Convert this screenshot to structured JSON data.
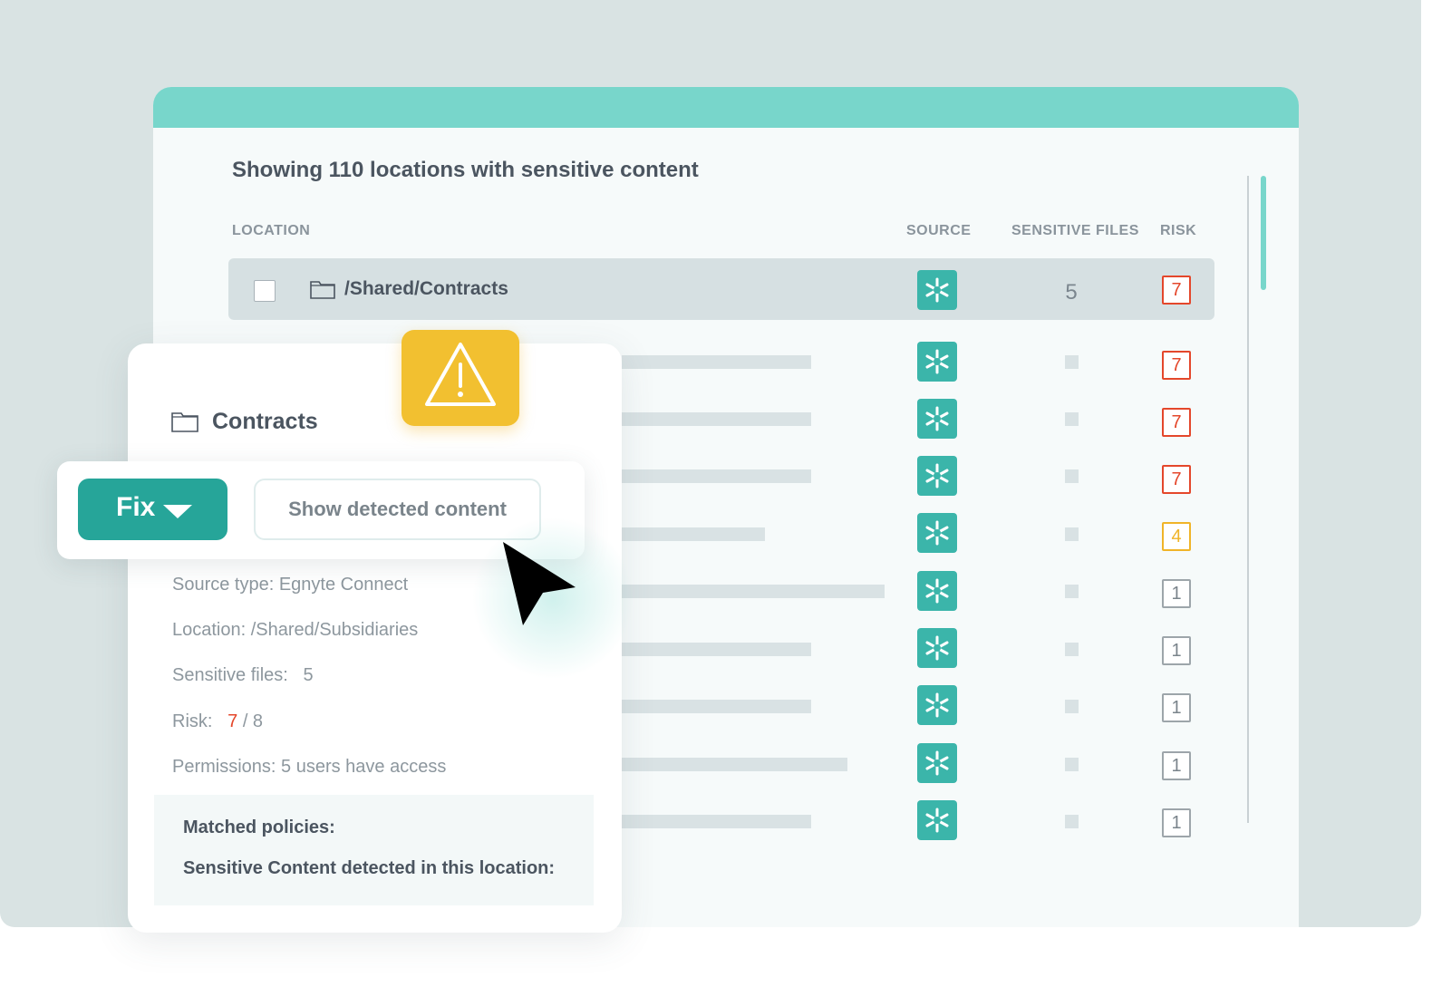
{
  "table": {
    "heading": "Showing 110 locations with sensitive content",
    "columns": {
      "location": "LOCATION",
      "source": "SOURCE",
      "sensitive_files": "SENSITIVE FILES",
      "risk": "RISK"
    },
    "selected_row": {
      "location": "/Shared/Contracts",
      "sensitive_files": "5",
      "risk": "7",
      "risk_level": "high"
    },
    "rows": [
      {
        "risk": "7",
        "risk_level": "high"
      },
      {
        "risk": "7",
        "risk_level": "high"
      },
      {
        "risk": "7",
        "risk_level": "high"
      },
      {
        "risk": "4",
        "risk_level": "medium"
      },
      {
        "risk": "1",
        "risk_level": "low"
      },
      {
        "risk": "1",
        "risk_level": "low"
      },
      {
        "risk": "1",
        "risk_level": "low"
      },
      {
        "risk": "1",
        "risk_level": "low"
      },
      {
        "risk": "1",
        "risk_level": "low"
      }
    ],
    "source_icon": "egnyte-asterisk-icon"
  },
  "detail_panel": {
    "title": "Contracts",
    "source_type": "Source type: Egnyte Connect",
    "location": "Location: /Shared/Subsidiaries",
    "sensitive_files_label": "Sensitive files:",
    "sensitive_files_value": "5",
    "risk_label": "Risk:",
    "risk_value": "7",
    "risk_max": "/ 8",
    "permissions": "Permissions: 5 users have access",
    "matched_policies": "Matched policies:",
    "sensitive_content": "Sensitive Content detected in this location:"
  },
  "actions": {
    "fix_label": "Fix",
    "show_label": "Show detected content"
  },
  "colors": {
    "accent": "#26a599",
    "header_bar": "#78d6cb",
    "source_icon": "#3bb5aa",
    "risk_high": "#e4472b",
    "risk_medium": "#f0b428",
    "risk_low": "#9da5aa",
    "warning": "#f2c030"
  }
}
